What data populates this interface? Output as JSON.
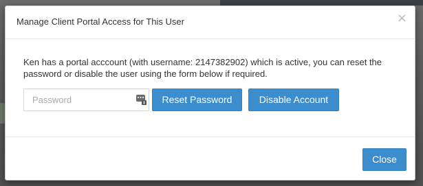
{
  "modal": {
    "title": "Manage Client Portal Access for This User",
    "close_glyph": "×",
    "message": "Ken has a portal acccount (with username: 2147382902) which is active, you can reset the password or disable the user using the form below if required.",
    "password_placeholder": "Password",
    "password_value": "",
    "password_icon": "password-manager-icon",
    "reset_label": "Reset Password",
    "disable_label": "Disable Account",
    "close_label": "Close"
  },
  "colors": {
    "button": "#3c8dce",
    "overlay": "#5f5f5f"
  }
}
